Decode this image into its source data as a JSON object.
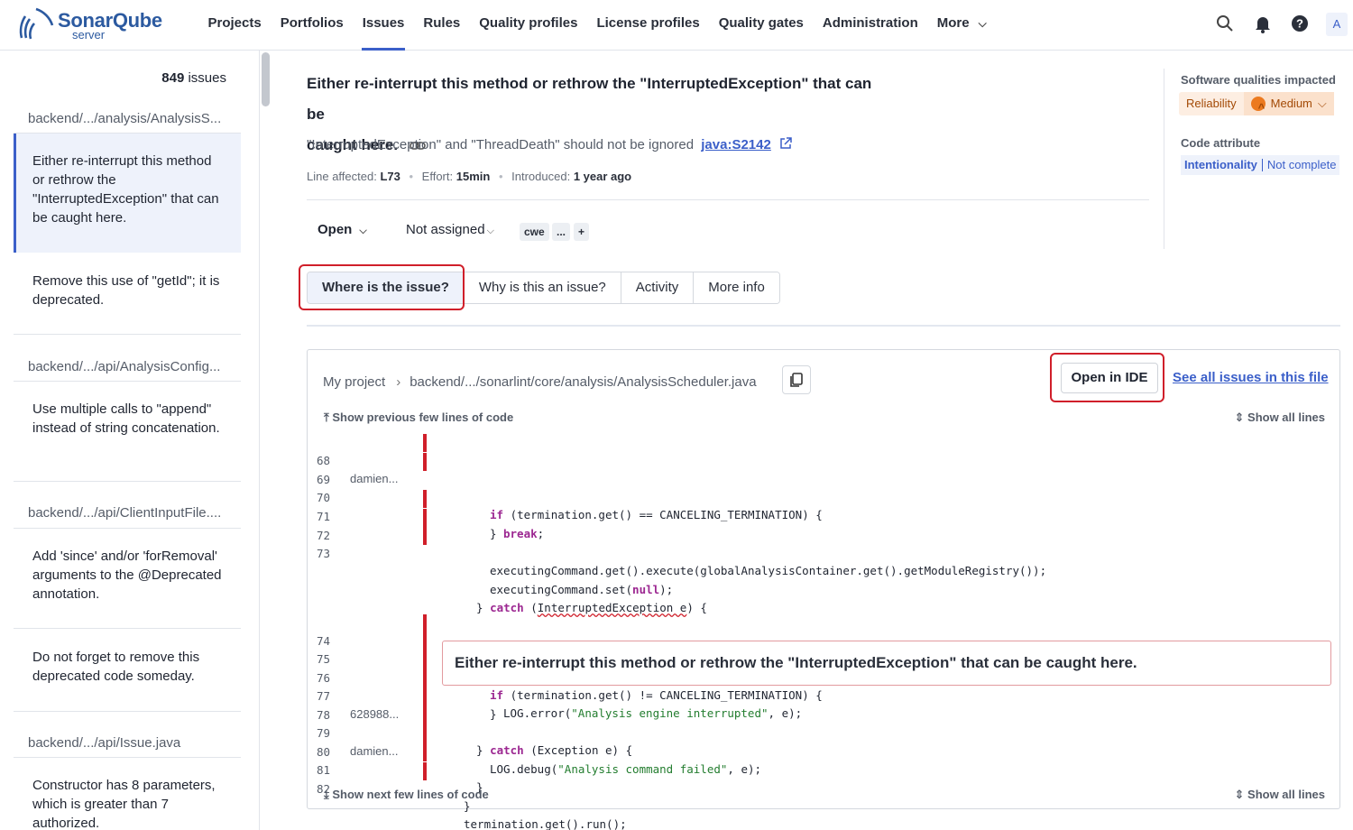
{
  "app": {
    "name": "SonarQube",
    "edition": "server"
  },
  "nav": {
    "items": [
      "Projects",
      "Portfolios",
      "Issues",
      "Rules",
      "Quality profiles",
      "License profiles",
      "Quality gates",
      "Administration",
      "More"
    ],
    "active": "Issues",
    "avatar": "A"
  },
  "sidebar": {
    "count": "849",
    "count_label": "issues",
    "groups": [
      {
        "file": "backend/.../analysis/AnalysisS...",
        "issues": [
          "Either re-interrupt this method or rethrow the \"InterruptedException\" that can be caught here.",
          "Remove this use of \"getId\"; it is deprecated."
        ]
      },
      {
        "file": "backend/.../api/AnalysisConfig...",
        "issues": [
          "Use multiple calls to \"append\" instead of string concatenation."
        ]
      },
      {
        "file": "backend/.../api/ClientInputFile....",
        "issues": [
          "Add 'since' and/or 'forRemoval' arguments to the @Deprecated annotation.",
          "Do not forget to remove this deprecated code someday."
        ]
      },
      {
        "file": "backend/.../api/Issue.java",
        "issues": [
          "Constructor has 8 parameters, which is greater than 7 authorized."
        ]
      }
    ]
  },
  "issue": {
    "title_line1": "Either re-interrupt this method or rethrow the \"InterruptedException\" that can be",
    "title_line2": "caught here.",
    "rule_text": "\"InterruptedException\" and \"ThreadDeath\" should not be ignored",
    "rule_key": "java:S2142",
    "line_label": "Line affected:",
    "line_value": "L73",
    "effort_label": "Effort:",
    "effort_value": "15min",
    "introduced_label": "Introduced:",
    "introduced_value": "1 year ago",
    "status": "Open",
    "assignee": "Not assigned",
    "tags": [
      "cwe",
      "...",
      "+"
    ]
  },
  "tabs": [
    "Where is the issue?",
    "Why is this an issue?",
    "Activity",
    "More info"
  ],
  "active_tab": "Where is the issue?",
  "right_panel": {
    "qualities_label": "Software qualities impacted",
    "quality": "Reliability",
    "severity": "Medium",
    "attribute_label": "Code attribute",
    "attribute": "Intentionality",
    "attribute_detail": "Not complete"
  },
  "code": {
    "project": "My project",
    "path": "backend/.../sonarlint/core/analysis/AnalysisScheduler.java",
    "open_ide": "Open in IDE",
    "see_all": "See all issues in this file",
    "show_prev": "Show previous few lines of code",
    "show_next": "Show next few lines of code",
    "show_all": "Show all lines",
    "inline_message": "Either re-interrupt this method or rethrow the \"InterruptedException\" that can be caught here.",
    "lines": [
      {
        "n": "68",
        "author": "damien...",
        "marked": true
      },
      {
        "n": "69",
        "author": "",
        "marked": true
      },
      {
        "n": "70",
        "author": "",
        "marked": false
      },
      {
        "n": "71",
        "author": "",
        "marked": true
      },
      {
        "n": "72",
        "author": "",
        "marked": true
      },
      {
        "n": "73",
        "author": "",
        "marked": true
      },
      {
        "n": "74",
        "author": "",
        "marked": true
      },
      {
        "n": "75",
        "author": "",
        "marked": true
      },
      {
        "n": "76",
        "author": "",
        "marked": false
      },
      {
        "n": "77",
        "author": "628988...",
        "marked": true
      },
      {
        "n": "78",
        "author": "",
        "marked": true
      },
      {
        "n": "79",
        "author": "damien...",
        "marked": true
      },
      {
        "n": "80",
        "author": "",
        "marked": true
      },
      {
        "n": "81",
        "author": "",
        "marked": true
      },
      {
        "n": "82",
        "author": "",
        "marked": true
      }
    ],
    "tokens": {
      "l68": [
        "if",
        " (termination.get() == CANCELING_TERMINATION) {"
      ],
      "l69": [
        "break",
        ";"
      ],
      "l70": "}",
      "l71": "executingCommand.get().execute(globalAnalysisContainer.get().getModuleRegistry());",
      "l72": [
        "executingCommand.set(",
        "null",
        ");"
      ],
      "l73": [
        "} ",
        "catch",
        " (",
        "InterruptedException e",
        ") {"
      ],
      "l74": [
        "if",
        " (termination.get() != CANCELING_TERMINATION) {"
      ],
      "l75": [
        "LOG.error(",
        "\"Analysis engine interrupted\"",
        ", e);"
      ],
      "l76": "}",
      "l77": [
        "} ",
        "catch",
        " (Exception e) {"
      ],
      "l78": [
        "LOG.debug(",
        "\"Analysis command failed\"",
        ", e);"
      ],
      "l79": "}",
      "l80": "}",
      "l81": "termination.get().run();",
      "l82": "}"
    }
  }
}
